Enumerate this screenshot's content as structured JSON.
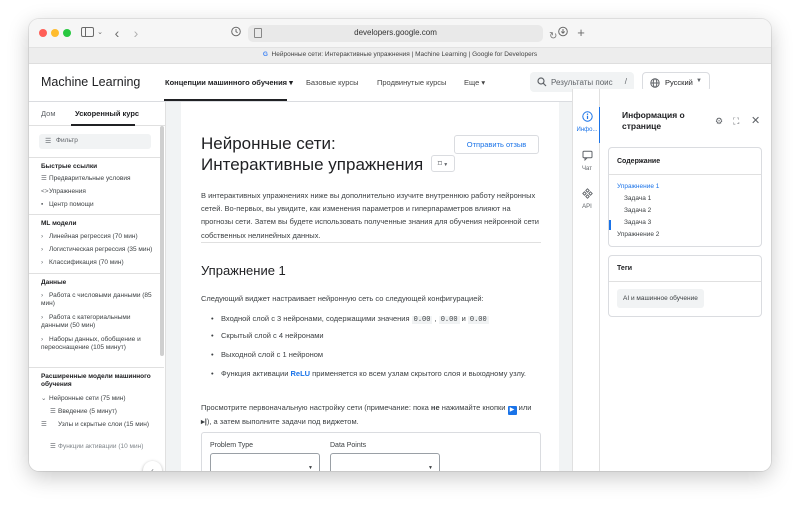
{
  "browser": {
    "url": "developers.google.com",
    "tab_title": "Нейронные сети: Интерактивные упражнения  |  Machine Learning  |  Google for Developers",
    "icons": {
      "sidebar_toggle": "sidebar-icon",
      "back": "chevron-left-icon",
      "forward": "chevron-right-icon",
      "privacy": "shield-icon",
      "reload": "reload-icon",
      "download": "download-icon",
      "new_tab": "plus-icon"
    }
  },
  "header": {
    "brand": "Machine Learning",
    "nav": [
      {
        "label": "Концепции машинного обучения ▾"
      },
      {
        "label": "Базовые курсы"
      },
      {
        "label": "Продвинутые курсы"
      },
      {
        "label": "Еще ▾"
      }
    ],
    "search": {
      "placeholder": "Результаты поис",
      "shortcut": "/"
    },
    "language": {
      "label": "Русский"
    }
  },
  "sidebar": {
    "tabs": [
      {
        "label": "Дом"
      },
      {
        "label": "Ускоренный курс"
      }
    ],
    "filter_placeholder": "Фильтр",
    "sections": [
      {
        "heading": "Быстрые ссылки",
        "items": [
          {
            "icon": "list-icon",
            "label": "Предварительные условия"
          },
          {
            "icon": "code-icon",
            "label": "Упражнения"
          },
          {
            "icon": "help-icon",
            "label": "Центр помощи"
          }
        ]
      },
      {
        "heading": "ML модели",
        "items": [
          {
            "label": "Линейная регрессия (70 мин)"
          },
          {
            "label": "Логистическая регрессия (35 мин)"
          },
          {
            "label": "Классификация (70 мин)"
          }
        ]
      },
      {
        "heading": "Данные",
        "items": [
          {
            "label": "Работа с числовыми данными (85 мин)"
          },
          {
            "label": "Работа с категориальными данными (50 мин)"
          },
          {
            "label": "Наборы данных, обобщение и переоснащение (105 минут)"
          }
        ]
      },
      {
        "heading": "Расширенные модели машинного обучения",
        "items": [
          {
            "label": "Нейронные сети (75 мин)"
          },
          {
            "label": "Введение (5 минут)"
          },
          {
            "label": "Узлы и скрытые слои (15 мин)"
          },
          {
            "label": "Функции активации (10 мин)"
          }
        ]
      }
    ]
  },
  "article": {
    "title": "Нейронные сети: Интерактивные упражнения",
    "feedback_label": "Отправить отзыв",
    "intro": "В интерактивных упражнениях ниже вы дополнительно изучите внутреннюю работу нейронных сетей. Во-первых, вы увидите, как изменения параметров и гиперпараметров влияют на прогнозы сети. Затем вы будете использовать полученные знания для обучения нейронной сети собственных нелинейных данных.",
    "exercise_heading": "Упражнение 1",
    "exercise_intro": "Следующий виджет настраивает нейронную сеть со следующей конфигурацией:",
    "bullets": {
      "input_prefix": "Входной слой с 3 нейронами, содержащими значения ",
      "input_values": [
        "0.00",
        "0.00",
        "0.00"
      ],
      "sep": " , ",
      "and": " и ",
      "hidden": "Скрытый слой с 4 нейронами",
      "output": "Выходной слой с 1 нейроном",
      "activation_prefix": "Функция активации ",
      "activation_link": "ReLU",
      "activation_suffix": " применяется ко всем узлам скрытого слоя и выходному узлу."
    },
    "note_prefix": "Просмотрите первоначальную настройку сети (примечание: пока ",
    "note_bold": "не",
    "note_mid": " нажимайте кнопки ",
    "note_or": " или ",
    "note_suffix": "), а затем выполните задачи под виджетом.",
    "widget": {
      "problem_type_label": "Problem Type",
      "data_points_label": "Data Points"
    }
  },
  "right_rail": {
    "items": [
      {
        "icon": "info-icon",
        "label": "Инфо..."
      },
      {
        "icon": "chat-icon",
        "label": "Чат"
      },
      {
        "icon": "api-icon",
        "label": "API"
      }
    ]
  },
  "info_panel": {
    "title": "Информация о странице",
    "toc_heading": "Содержание",
    "toc": [
      {
        "label": "Упражнение 1",
        "level": 1,
        "active": true
      },
      {
        "label": "Задача 1",
        "level": 2
      },
      {
        "label": "Задача 2",
        "level": 2
      },
      {
        "label": "Задача 3",
        "level": 2
      },
      {
        "label": "Упражнение 2",
        "level": 1
      }
    ],
    "tags_heading": "Теги",
    "tags": [
      "AI и машинное обучение"
    ]
  },
  "colors": {
    "accent": "#1a73e8",
    "text": "#202124",
    "muted": "#5f6368",
    "border": "#dadce0"
  }
}
